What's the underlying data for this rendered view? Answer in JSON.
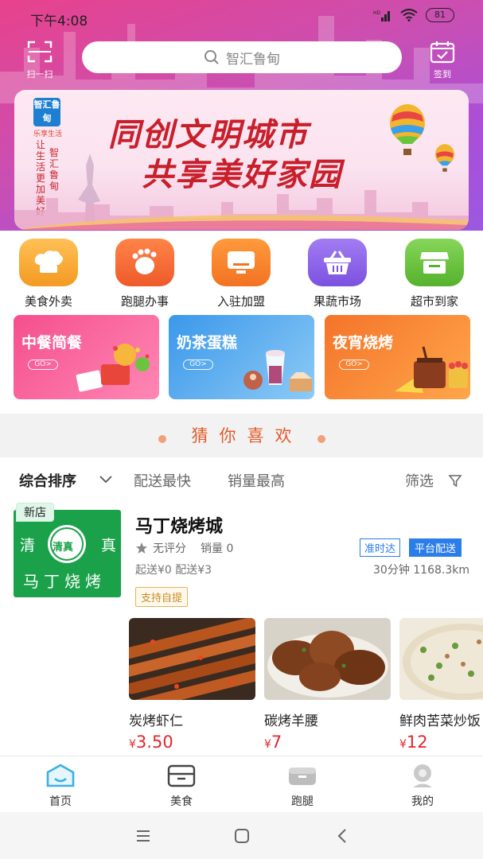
{
  "status_bar": {
    "time": "下午4:08",
    "signal": "HD",
    "battery": "81"
  },
  "top_bar": {
    "scan_label": "扫一扫",
    "search_placeholder": "智汇鲁甸",
    "signin_label": "签到"
  },
  "banner": {
    "logo_text": "智汇鲁甸",
    "logo_sub": "乐享生活",
    "vertical_left": "让生活更加美好",
    "vertical_right": "智汇鲁甸",
    "line1": "同创文明城市",
    "line2": "共享美好家园"
  },
  "categories": [
    {
      "label": "美食外卖",
      "icon": "chef-hat-icon",
      "color": "#f7a53a"
    },
    {
      "label": "跑腿办事",
      "icon": "footprint-icon",
      "color": "#f46b35"
    },
    {
      "label": "入驻加盟",
      "icon": "monitor-icon",
      "color": "#f6862c"
    },
    {
      "label": "果蔬市场",
      "icon": "basket-icon",
      "color": "#8d63e8"
    },
    {
      "label": "超市到家",
      "icon": "store-icon",
      "color": "#6cc43e"
    }
  ],
  "promos": [
    {
      "title": "中餐简餐",
      "go": "GO>",
      "color_from": "#f54f8e",
      "color_to": "#ff87b4"
    },
    {
      "title": "奶茶蛋糕",
      "go": "GO>",
      "color_from": "#3a98ea",
      "color_to": "#8dcaf6"
    },
    {
      "title": "夜宵烧烤",
      "go": "GO>",
      "color_from": "#f4742a",
      "color_to": "#ffa64a"
    }
  ],
  "guess_title": "猜你喜欢",
  "sort_bar": {
    "items": [
      "综合排序",
      "配送最快",
      "销量最高"
    ],
    "filter": "筛选"
  },
  "shop": {
    "new_tag": "新店",
    "image_text_left": "清",
    "image_text_center": "清真",
    "image_text_right": "真",
    "image_text_bottom": "马丁烧烤",
    "name": "马丁烧烤城",
    "rating": "无评分",
    "sales": "销量 0",
    "fees": "起送¥0  配送¥3",
    "tag_ontime": "准时达",
    "tag_platform": "平台配送",
    "distance": "30分钟 1168.3km",
    "self_pickup": "支持自提"
  },
  "dishes": [
    {
      "name": "炭烤虾仁",
      "currency": "¥",
      "price": "3.50"
    },
    {
      "name": "碳烤羊腰",
      "currency": "¥",
      "price": "7"
    },
    {
      "name": "鲜肉苦菜炒饭",
      "currency": "¥",
      "price": "12"
    }
  ],
  "tab_bar": [
    {
      "label": "首页",
      "icon": "home-icon",
      "active": true
    },
    {
      "label": "美食",
      "icon": "food-box-icon",
      "active": false
    },
    {
      "label": "跑腿",
      "icon": "errand-box-icon",
      "active": false
    },
    {
      "label": "我的",
      "icon": "profile-icon",
      "active": false
    }
  ],
  "colors": {
    "accent_blue": "#2b7de9",
    "price_red": "#e4262f",
    "guess_orange": "#e35b2c",
    "active_tab": "#3bb0e6"
  }
}
